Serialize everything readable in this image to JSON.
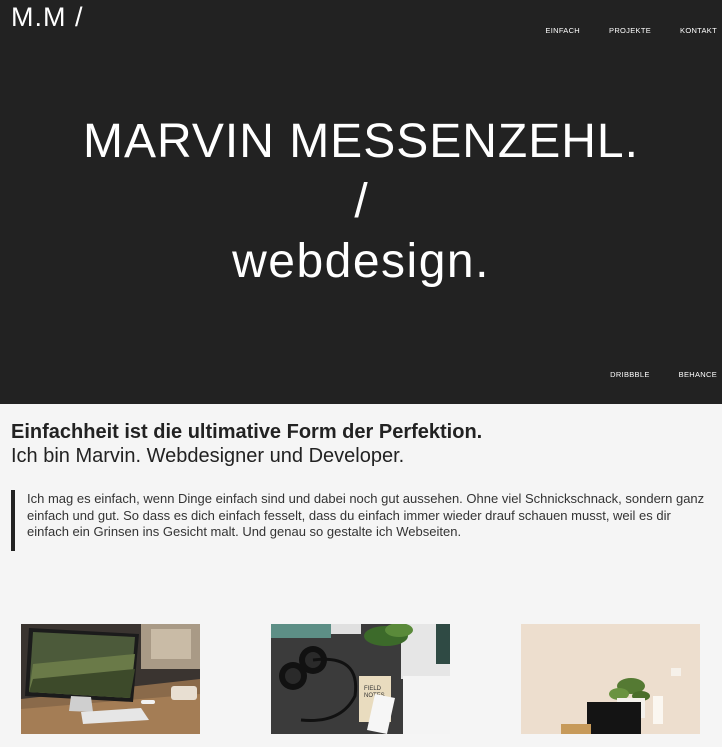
{
  "header": {
    "logo": "M.M /",
    "nav": [
      "EINFACH",
      "PROJEKTE",
      "KONTAKT"
    ]
  },
  "hero": {
    "line1": "MARVIN MESSENZEHL.",
    "line2": "/",
    "line3": "webdesign."
  },
  "social": [
    "DRIBBBLE",
    "BEHANCE"
  ],
  "intro": {
    "headline": "Einfachheit ist die ultimative Form der Perfektion.",
    "subheadline": "Ich bin Marvin. Webdesigner und Developer.",
    "quote": "Ich mag es einfach, wenn Dinge einfach sind und dabei noch gut aussehen. Ohne viel Schnickschnack, sondern ganz einfach und gut. So dass es dich einfach fesselt, dass du einfach immer wieder drauf schauen musst, weil es dir einfach ein Grinsen ins Gesicht malt. Und genau so gestalte ich Webseiten."
  },
  "gallery": [
    {
      "name": "project-thumb-imac-desk"
    },
    {
      "name": "project-thumb-headphones-notebook"
    },
    {
      "name": "project-thumb-plant-desk"
    }
  ],
  "colors": {
    "hero_bg": "#222222",
    "page_bg": "#f5f5f5",
    "text": "#222222"
  }
}
